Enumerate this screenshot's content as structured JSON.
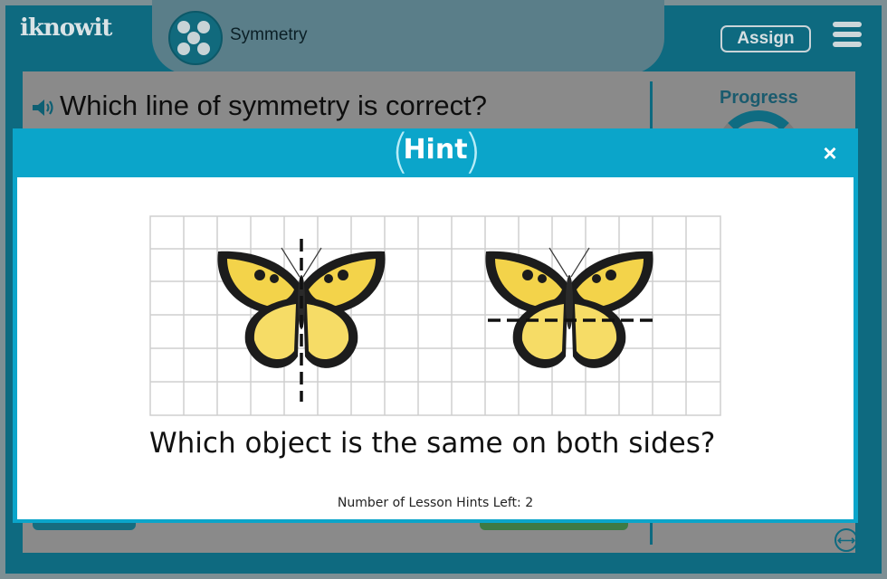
{
  "app": {
    "logo_text": "iknowit",
    "topic": "Symmetry",
    "assign_label": "Assign"
  },
  "question": {
    "text": "Which line of symmetry is correct?"
  },
  "sidebar": {
    "progress_label": "Progress"
  },
  "hint_modal": {
    "title": "Hint",
    "close_label": "×",
    "hint_text": "Which object is the same on both sides?",
    "hints_left": "Number of Lesson Hints Left: 2"
  },
  "colors": {
    "header_bg": "#0e6a80",
    "modal_accent": "#0ba5ca",
    "butterfly_yellow": "#f3d34a",
    "butterfly_black": "#1a1a1a"
  },
  "icons": [
    "speaker-icon",
    "menu-icon",
    "close-icon",
    "resize-icon",
    "topic-icon"
  ]
}
